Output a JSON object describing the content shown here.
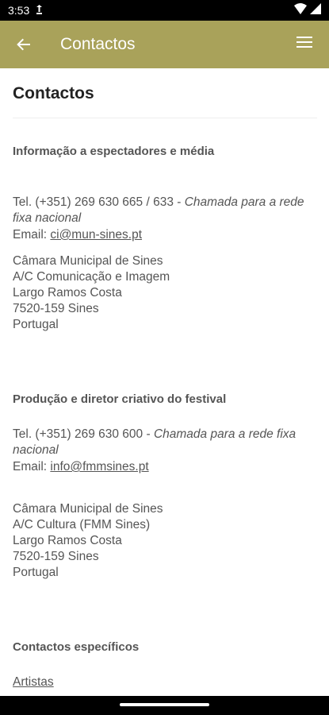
{
  "status_bar": {
    "time": "3:53",
    "icons": [
      "sync-icon",
      "wifi-icon",
      "signal-icon"
    ]
  },
  "app_bar": {
    "title": "Contactos",
    "back_icon": "arrow-left-icon",
    "menu_icon": "hamburger-menu-icon",
    "color": "#a9a25a"
  },
  "page": {
    "title": "Contactos",
    "sections": [
      {
        "title": "Informação a espectadores e média",
        "phone": "Tel. (+351) 269 630 665 / 633 - ",
        "phone_note": "Chamada para a rede fixa nacional",
        "email_label": "Email: ",
        "email": "ci@mun-sines.pt",
        "address": [
          "Câmara Municipal de Sines",
          "A/C Comunicação e Imagem",
          "Largo Ramos Costa",
          "7520-159 Sines",
          "Portugal"
        ]
      },
      {
        "title": "Produção e diretor criativo do festival",
        "phone": "Tel. (+351) 269 630 600 - ",
        "phone_note": "Chamada para a rede fixa nacional",
        "email_label": "Email: ",
        "email": "info@fmmsines.pt",
        "address": [
          "Câmara Municipal de Sines",
          "A/C Cultura (FMM Sines)",
          "Largo Ramos Costa",
          "7520-159 Sines",
          "Portugal"
        ]
      }
    ],
    "specific": {
      "title": "Contactos específicos",
      "links": [
        "Artistas"
      ]
    }
  }
}
